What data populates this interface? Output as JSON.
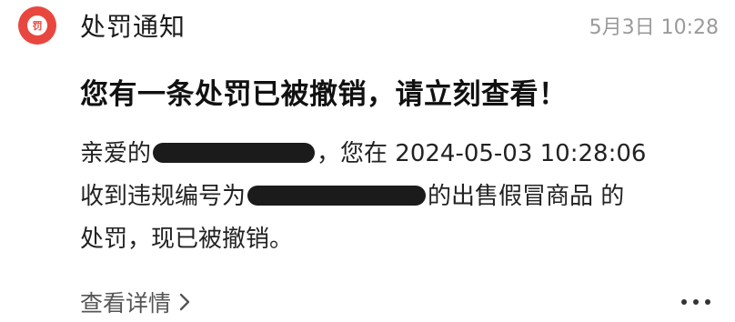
{
  "header": {
    "app_icon_label": "罚",
    "sender": "处罚通知",
    "time": "5月3日 10:28"
  },
  "message": {
    "title": "您有一条处罚已被撤销，请立刻查看！",
    "line1_prefix": "亲爱的",
    "line1_suffix": "，您在 2024-05-03 10:28:06",
    "line2_prefix": "收到违规编号为",
    "line2_suffix": "的出售假冒商品 的",
    "line3": "处罚，现已被撤销。"
  },
  "footer": {
    "detail_label": "查看详情",
    "icons": {
      "chevron": "chevron-right-icon",
      "more": "more-dots-icon"
    }
  },
  "colors": {
    "accent": "#e8473f",
    "text_primary": "#1a1a1a",
    "text_secondary": "#9a9a9a",
    "link": "#555555"
  }
}
